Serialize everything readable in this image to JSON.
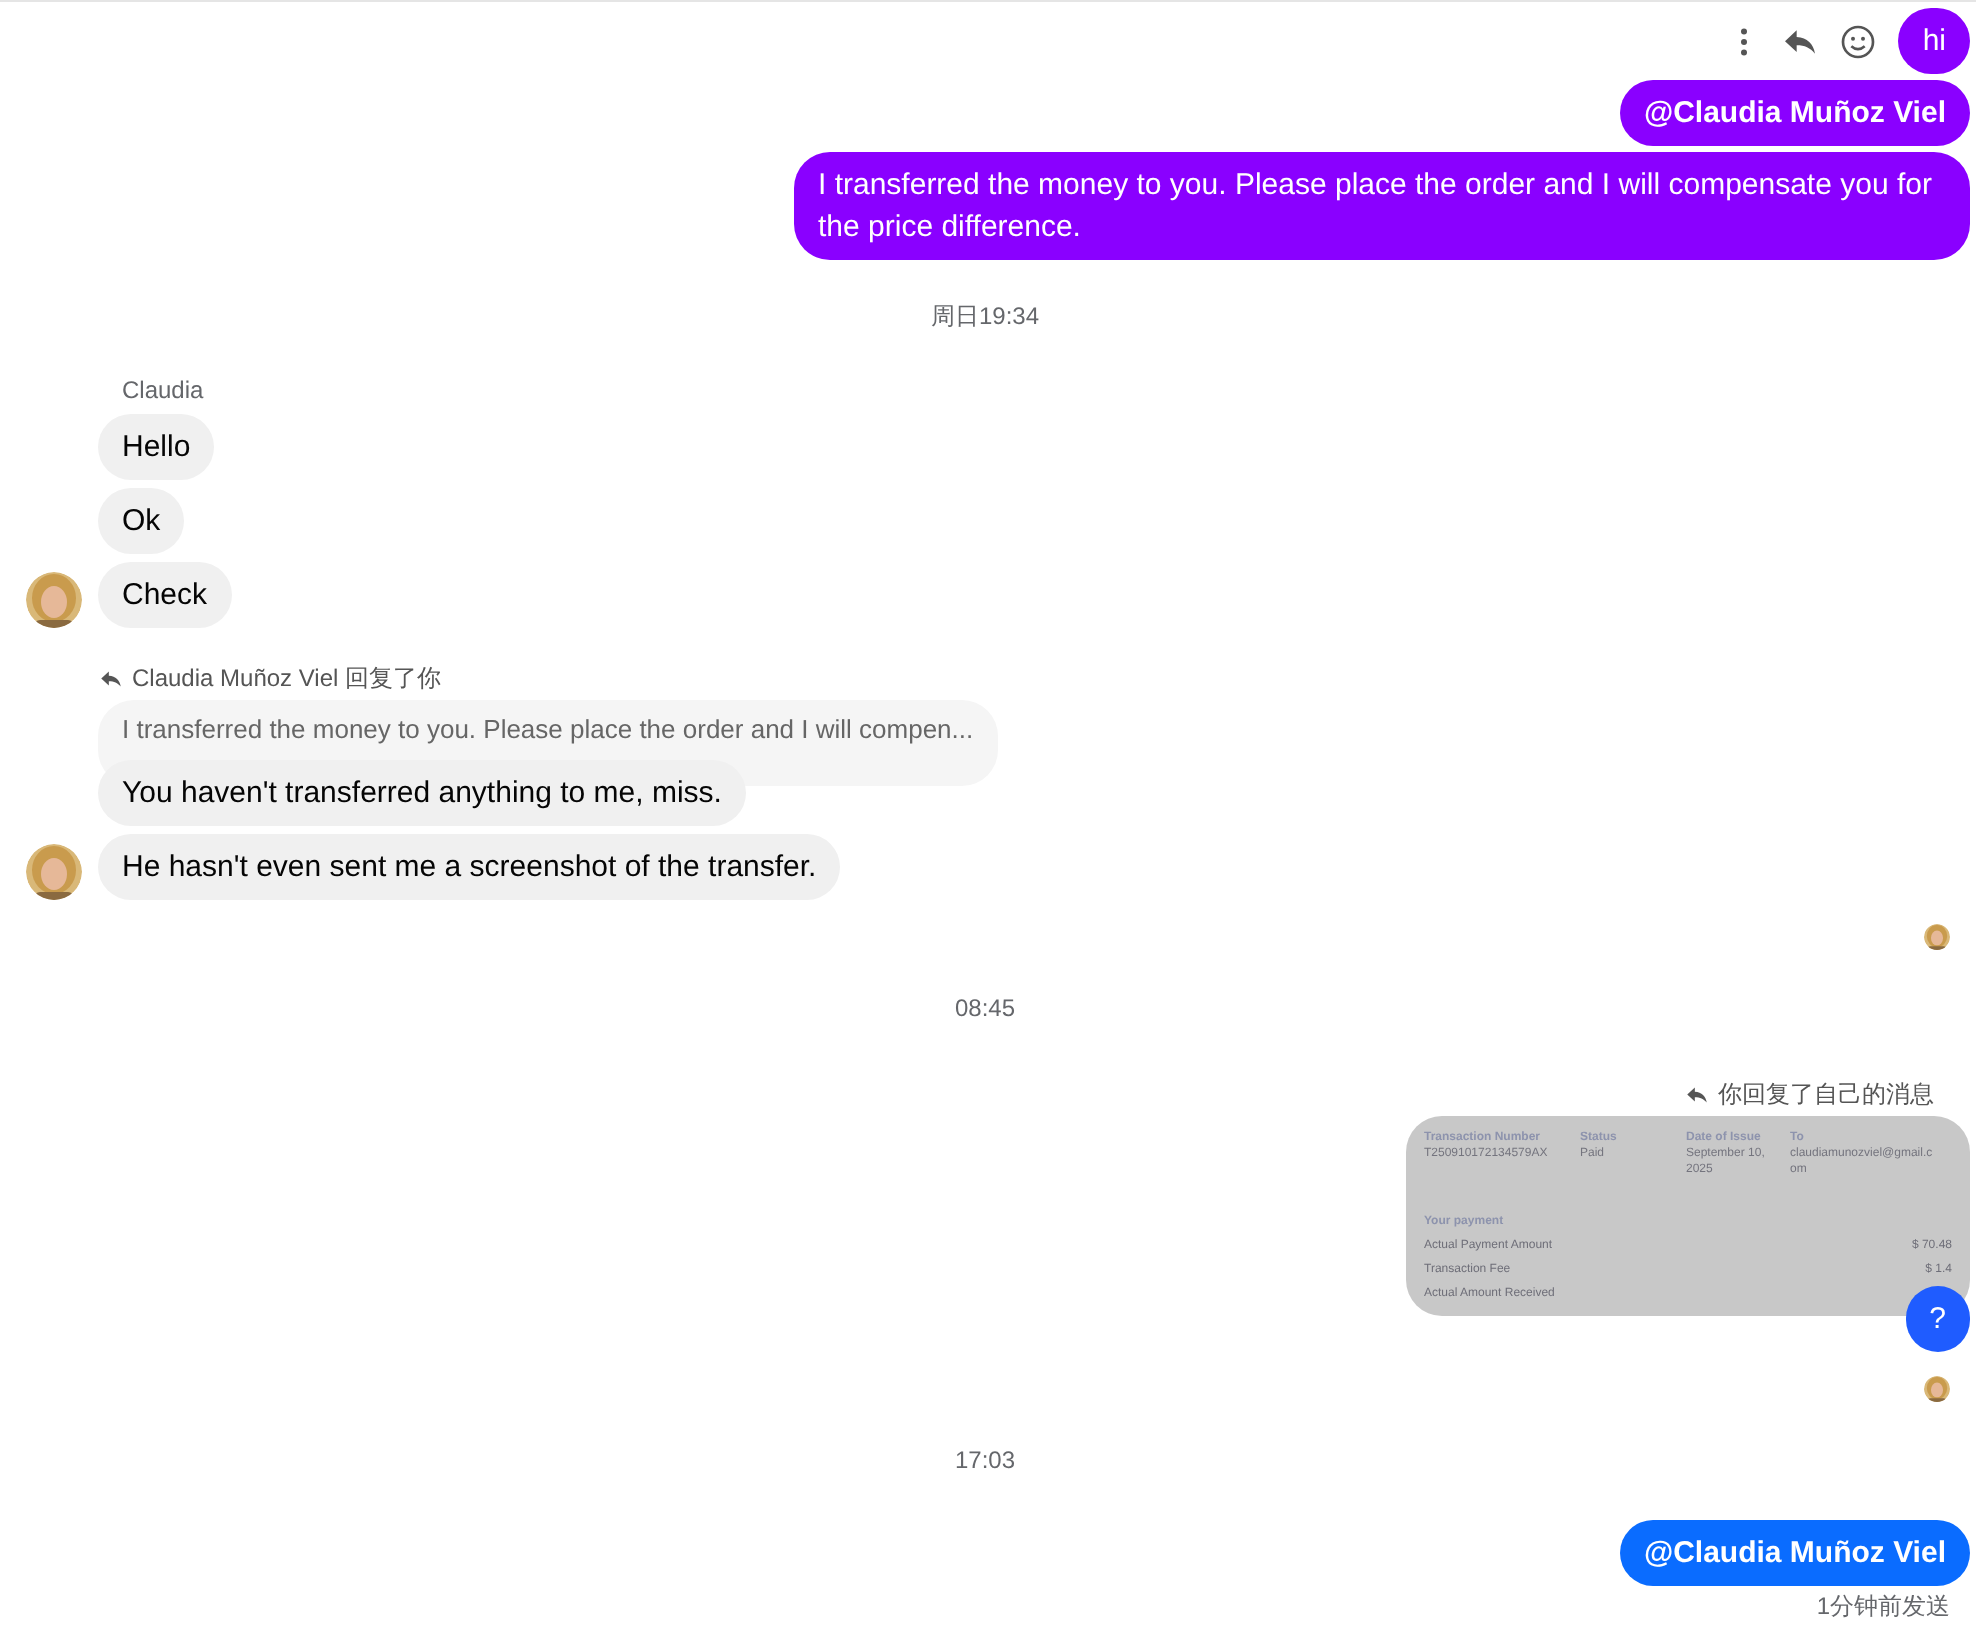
{
  "conversation": [
    {
      "kind": "outgoing",
      "hover_actions": true,
      "bubbles": [
        {
          "text": "hi",
          "mention": false,
          "color": "#8a00ff"
        },
        {
          "text": "@Claudia Muñoz Viel",
          "mention": true,
          "color": "#8a00ff"
        },
        {
          "text": "I transferred the money to you. Please place the order and I will compensate you for the price difference.",
          "mention": false,
          "color": "#8a00ff"
        }
      ]
    },
    {
      "kind": "timestamp",
      "text": "周日19:34"
    },
    {
      "kind": "incoming",
      "sender": "Claudia",
      "bubbles": [
        {
          "text": "Hello"
        },
        {
          "text": "Ok"
        },
        {
          "text": "Check"
        }
      ]
    },
    {
      "kind": "incoming",
      "reply_label": "Claudia Muñoz Viel 回复了你",
      "quoted": "I transferred the money to you. Please place the order and I will compen...",
      "bubbles": [
        {
          "text": "You haven't transferred anything to me, miss."
        },
        {
          "text": "He hasn't even sent me a screenshot of the transfer."
        }
      ]
    },
    {
      "kind": "read_receipt"
    },
    {
      "kind": "timestamp",
      "text": "08:45"
    },
    {
      "kind": "outgoing",
      "reply_label": "你回复了自己的消息",
      "attachment": {
        "kind": "document",
        "columns": [
          {
            "label": "Transaction Number",
            "value": "T250910172134579AX"
          },
          {
            "label": "Status",
            "value": "Paid"
          },
          {
            "label": "Date of Issue",
            "value": "September 10, 2025"
          },
          {
            "label": "To",
            "value": "claudiamunozviel@gmail.com"
          }
        ],
        "section": "Your payment",
        "rows": [
          {
            "label": "Actual Payment Amount",
            "value": "$ 70.48"
          },
          {
            "label": "Transaction Fee",
            "value": "$ 1.4"
          },
          {
            "label": "Actual Amount Received"
          }
        ]
      },
      "bubbles": [
        {
          "text": "?",
          "mention": false,
          "color": "#1f5cff"
        }
      ]
    },
    {
      "kind": "read_receipt"
    },
    {
      "kind": "timestamp",
      "text": "17:03"
    },
    {
      "kind": "outgoing",
      "bubbles": [
        {
          "text": "@Claudia Muñoz Viel",
          "mention": true,
          "color": "#0a6cff"
        }
      ],
      "status": "1分钟前发送"
    }
  ]
}
